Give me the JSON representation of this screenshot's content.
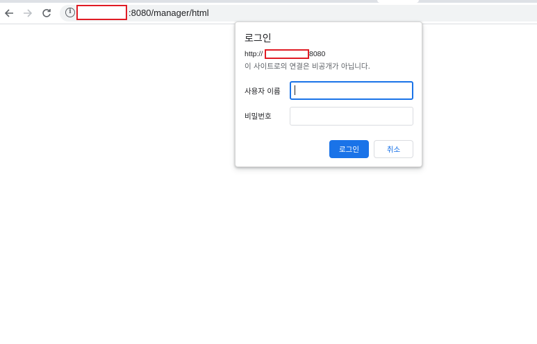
{
  "toolbar": {
    "url": ":8080/manager/html"
  },
  "dialog": {
    "title": "로그인",
    "origin_prefix": "http://",
    "origin_suffix": "8080",
    "warning": "이 사이트로의 연결은 비공개가 아닙니다.",
    "username_label": "사용자 이름",
    "username_value": "",
    "password_label": "비밀번호",
    "password_value": "",
    "login_button": "로그인",
    "cancel_button": "취소"
  },
  "colors": {
    "accent": "#1a73e8",
    "redaction": "#e01b24"
  },
  "icons": [
    "back-arrow-icon",
    "forward-arrow-icon",
    "reload-icon",
    "info-icon"
  ]
}
